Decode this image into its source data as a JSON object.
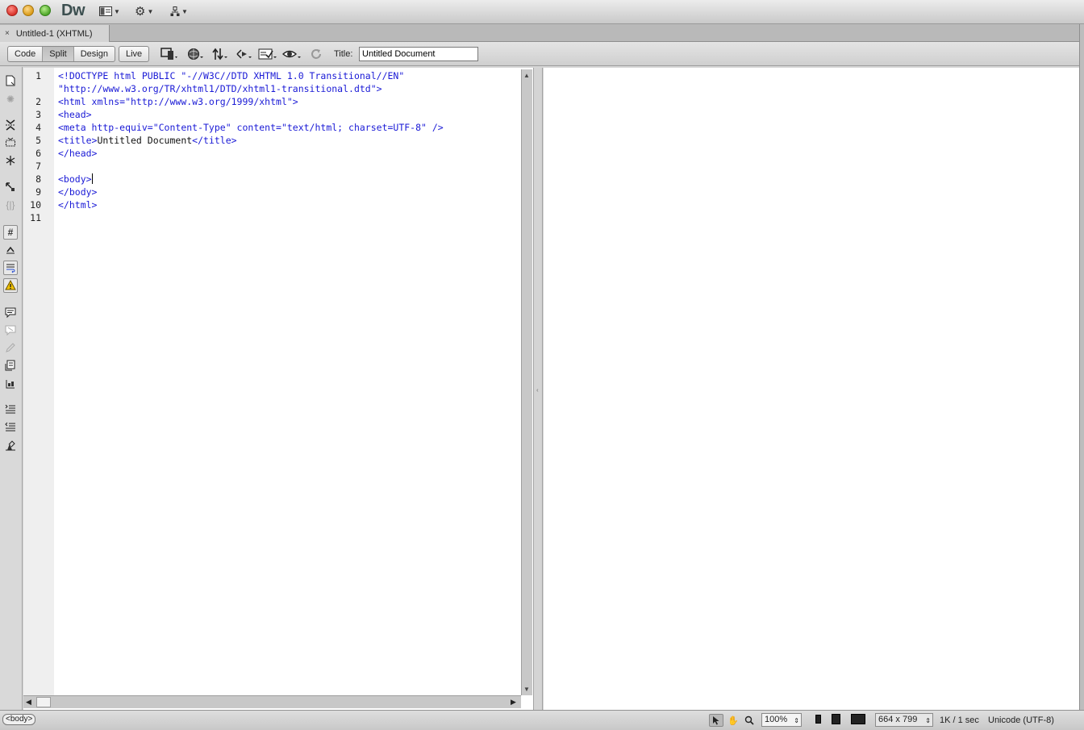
{
  "app": {
    "logo": "Dw"
  },
  "document_tab": {
    "close_glyph": "×",
    "label": "Untitled-1 (XHTML)"
  },
  "toolbar": {
    "view_buttons": [
      "Code",
      "Split",
      "Design"
    ],
    "active_view": "Split",
    "live_label": "Live",
    "title_label": "Title:",
    "title_value": "Untitled Document"
  },
  "code": {
    "line_numbers": [
      "1",
      "",
      "2",
      "3",
      "4",
      "5",
      "6",
      "7",
      "8",
      "9",
      "10",
      "11"
    ],
    "lines": [
      "<!DOCTYPE html PUBLIC \"-//W3C//DTD XHTML 1.0 Transitional//EN\"",
      "\"http://www.w3.org/TR/xhtml1/DTD/xhtml1-transitional.dtd\">",
      "<html xmlns=\"http://www.w3.org/1999/xhtml\">",
      "<head>",
      "<meta http-equiv=\"Content-Type\" content=\"text/html; charset=UTF-8\" />",
      "<title>",
      "Untitled Document",
      "</title>",
      "</head>",
      "<body>",
      "</body>",
      "</html>"
    ]
  },
  "status": {
    "tag_selector": "<body>",
    "zoom": "100%",
    "window_size": "664 x 799",
    "download": "1K / 1 sec",
    "encoding": "Unicode (UTF-8)"
  },
  "icons": {
    "zoom_updown": "⇕",
    "size_updown": "⇕"
  }
}
